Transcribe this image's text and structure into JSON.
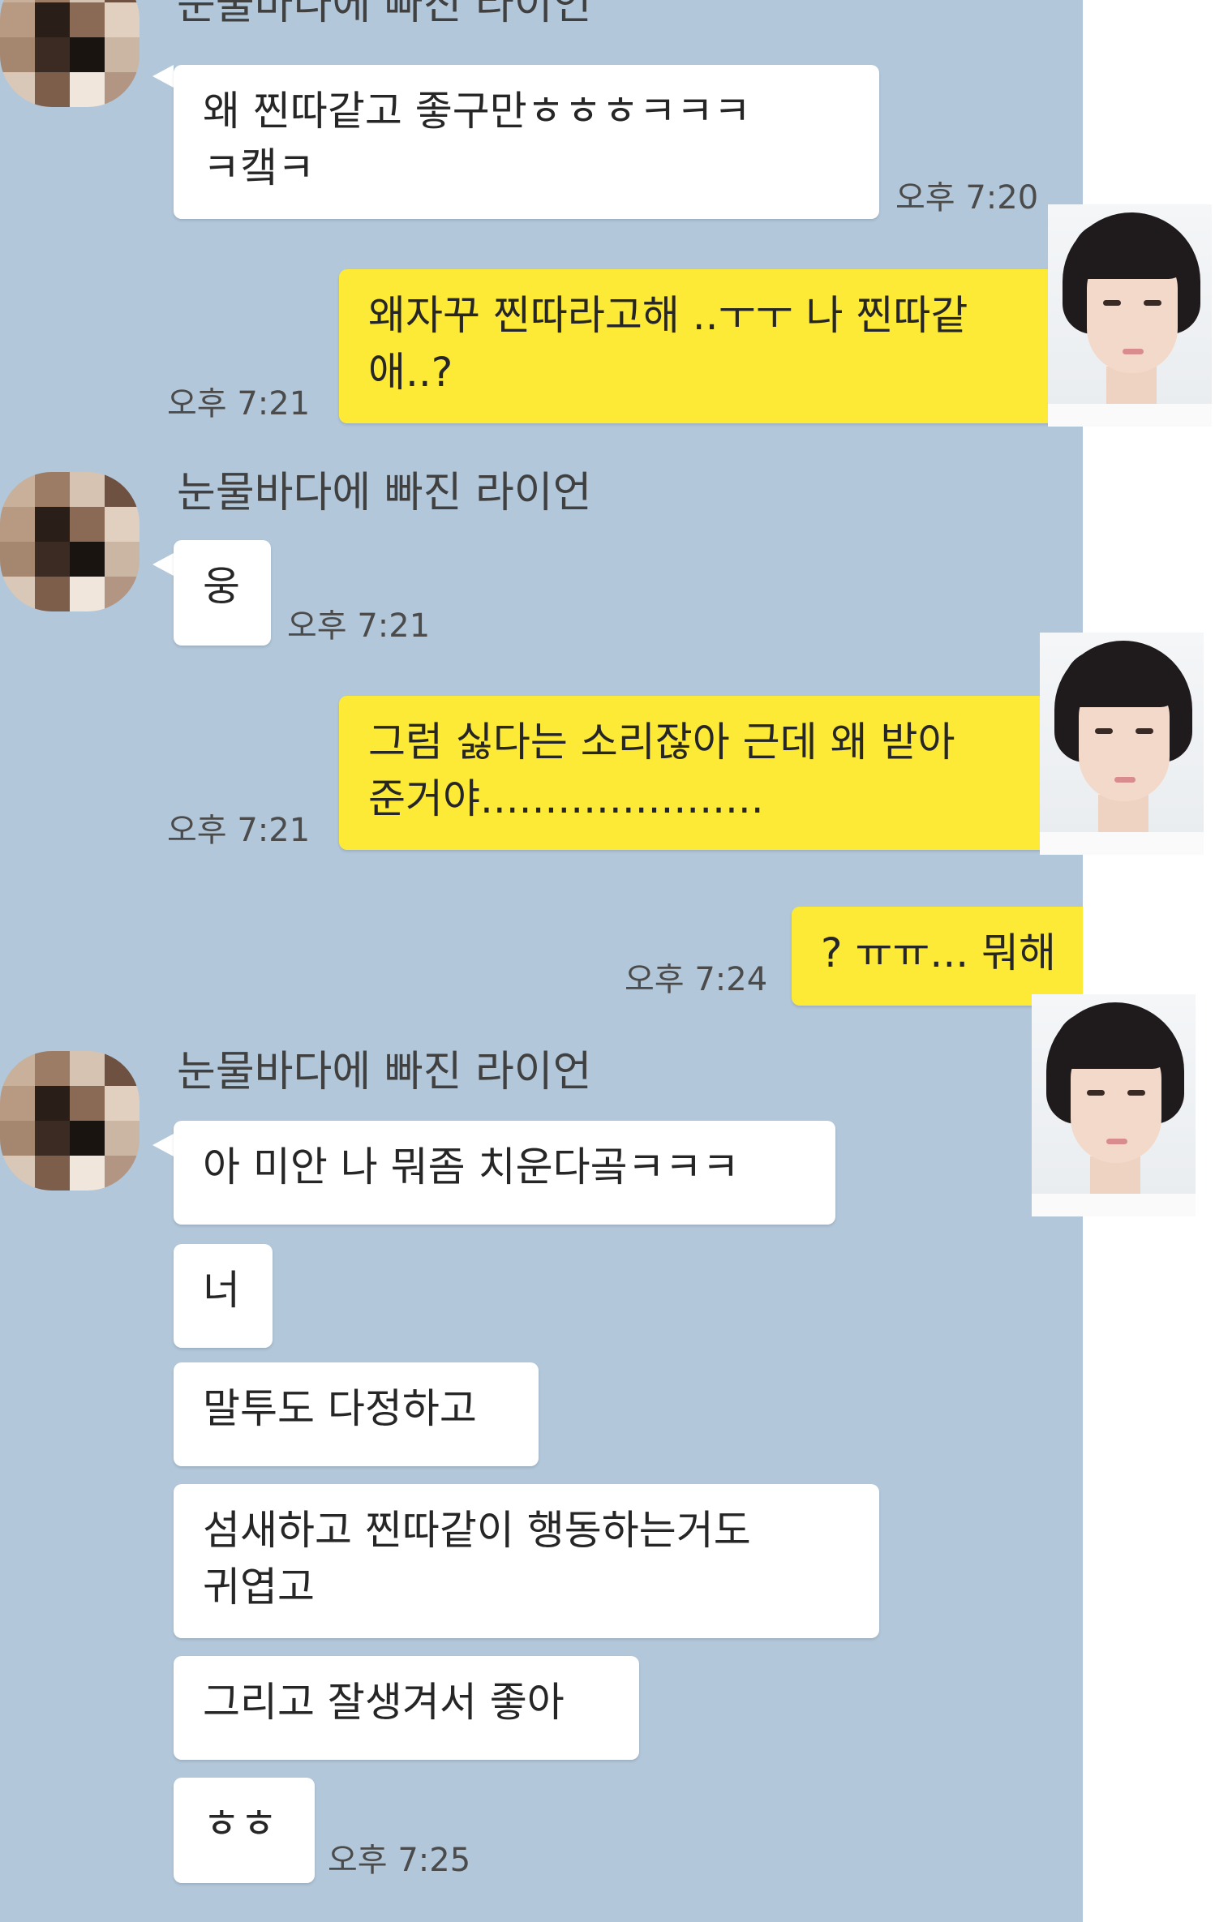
{
  "chat": {
    "sender_name": "눈물바다에 빠진 라이언",
    "messages": [
      {
        "from": "other",
        "text": "왜 찐따같고 좋구만ㅎㅎㅎㅋㅋㅋ\nㅋ캨ㅋ",
        "time": "오후 7:20"
      },
      {
        "from": "me",
        "text": "왜자꾸 찐따라고해 ..ㅜㅜ 나 찐따같\n애..?",
        "time": "오후 7:21"
      },
      {
        "from": "other",
        "text": "웅",
        "time": "오후 7:21"
      },
      {
        "from": "me",
        "text": "그럼 싫다는 소리잖아 근데 왜 받아\n준거야......................",
        "time": "오후 7:21"
      },
      {
        "from": "me",
        "text": "? ㅠㅠ... 뭐해",
        "time": "오후 7:24"
      },
      {
        "from": "other",
        "text": "아 미안 나 뭐좀 치운다곸ㅋㅋㅋ"
      },
      {
        "from": "other",
        "text": "너"
      },
      {
        "from": "other",
        "text": "말투도 다정하고"
      },
      {
        "from": "other",
        "text": "섬새하고 찐따같이 행동하는거도\n귀엽고"
      },
      {
        "from": "other",
        "text": "그리고 잘생겨서 좋아"
      },
      {
        "from": "other",
        "text": "ㅎㅎ",
        "time": "오후 7:25"
      }
    ]
  },
  "colors": {
    "background": "#b2c7da",
    "my_bubble": "#fdea37",
    "their_bubble": "#ffffff"
  },
  "icons": {
    "their_avatar": "pixelated-avatar-icon",
    "my_overlay": "portrait-photo"
  }
}
